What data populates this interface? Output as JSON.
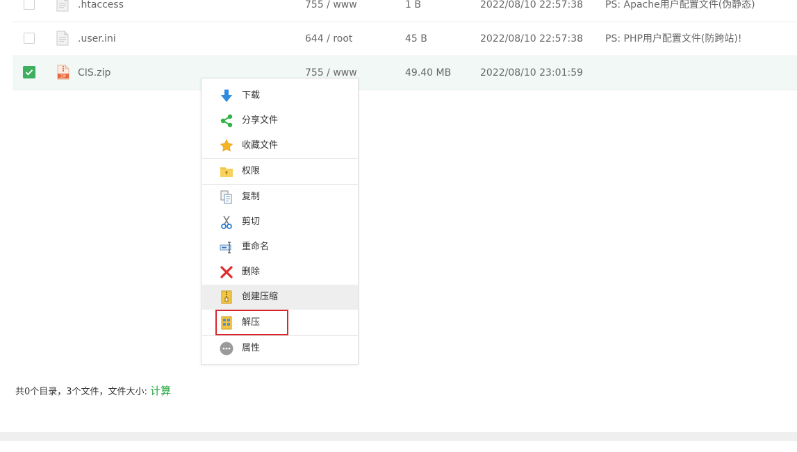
{
  "files": [
    {
      "name": ".htaccess",
      "perm": "755 / www",
      "size": "1 B",
      "date": "2022/08/10 22:57:38",
      "note": "PS: Apache用户配置文件(伪静态)",
      "checked": false,
      "icon": "file-icon"
    },
    {
      "name": ".user.ini",
      "perm": "644 / root",
      "size": "45 B",
      "date": "2022/08/10 22:57:38",
      "note": "PS: PHP用户配置文件(防跨站)!",
      "checked": false,
      "icon": "file-icon"
    },
    {
      "name": "CIS.zip",
      "perm": "755 / www",
      "size": "49.40 MB",
      "date": "2022/08/10 23:01:59",
      "note": "",
      "checked": true,
      "icon": "zip-file-icon"
    }
  ],
  "context_menu": {
    "download": "下载",
    "share": "分享文件",
    "favorite": "收藏文件",
    "permission": "权限",
    "copy": "复制",
    "cut": "剪切",
    "rename": "重命名",
    "delete": "删除",
    "compress": "创建压缩",
    "extract": "解压",
    "properties": "属性"
  },
  "summary": {
    "text": "共0个目录，3个文件，文件大小: ",
    "calc_link": "计算"
  },
  "colors": {
    "accent_green": "#20a53a",
    "checkbox_green": "#3cb05d",
    "highlight_red": "#d9262c",
    "selected_row_bg": "#f1f8f5"
  }
}
